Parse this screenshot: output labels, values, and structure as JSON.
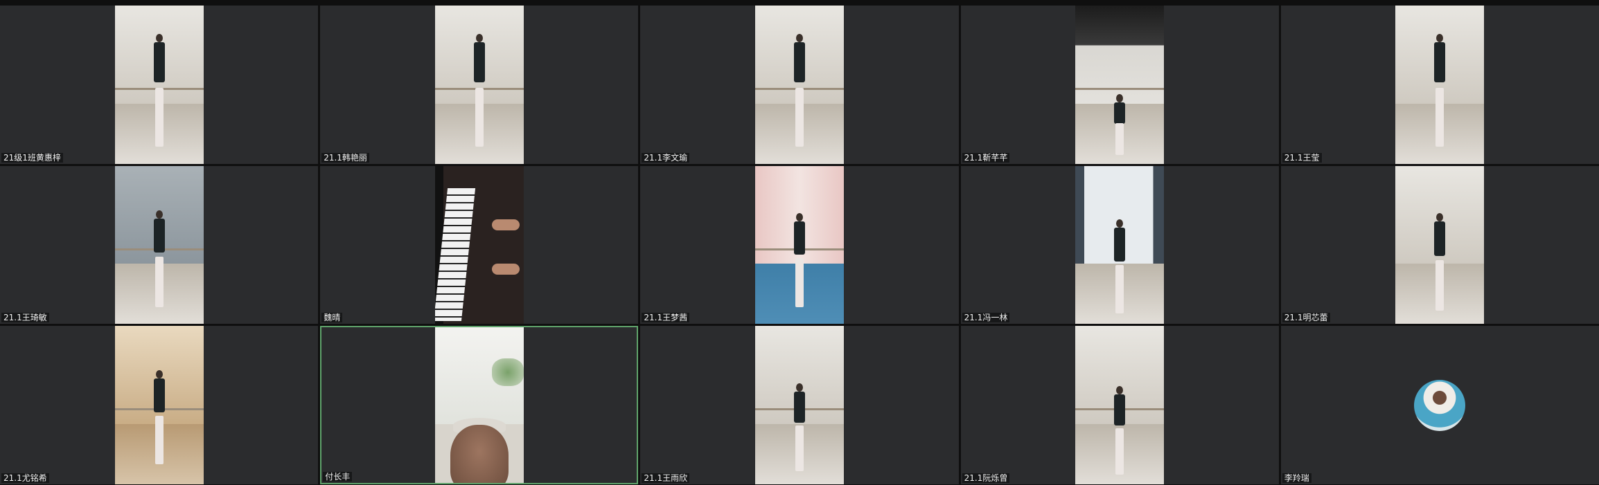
{
  "participants": [
    {
      "name": "21级1班黄惠梓",
      "scene": "dancer"
    },
    {
      "name": "21.1韩艳丽",
      "scene": "dancer"
    },
    {
      "name": "21.1李文瑜",
      "scene": "dancer"
    },
    {
      "name": "21.1靳芊芊",
      "scene": "dancer-dark"
    },
    {
      "name": "21.1王莹",
      "scene": "dancer"
    },
    {
      "name": "21.1王琦敏",
      "scene": "dancer-grey"
    },
    {
      "name": "魏晴",
      "scene": "piano"
    },
    {
      "name": "21.1王梦茜",
      "scene": "dancer-blue"
    },
    {
      "name": "21.1冯一林",
      "scene": "dancer-window"
    },
    {
      "name": "21.1明芯蕾",
      "scene": "dancer"
    },
    {
      "name": "21.1尤铭希",
      "scene": "dancer-warm"
    },
    {
      "name": "付长丰",
      "scene": "teacher",
      "active_speaker": true
    },
    {
      "name": "21.1王雨欣",
      "scene": "dancer"
    },
    {
      "name": "21.1阮烁曾",
      "scene": "dancer"
    },
    {
      "name": "李羚瑞",
      "scene": "avatar"
    }
  ],
  "colors": {
    "tile_bg": "#2b2c2e",
    "active_border": "#5fa36b",
    "label_text": "#f2f2f2"
  }
}
